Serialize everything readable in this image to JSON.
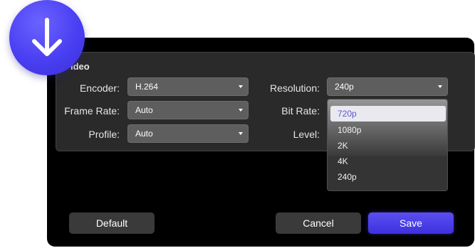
{
  "section": {
    "title": "ideo"
  },
  "fields": {
    "encoder": {
      "label": "Encoder:",
      "value": "H.264"
    },
    "frame_rate": {
      "label": "Frame Rate:",
      "value": "Auto"
    },
    "profile": {
      "label": "Profile:",
      "value": "Auto"
    },
    "resolution": {
      "label": "Resolution:",
      "value": "240p"
    },
    "bit_rate": {
      "label": "Bit Rate:"
    },
    "level": {
      "label": "Level:"
    }
  },
  "resolution_menu": {
    "options": [
      "720p",
      "1080p",
      "2K",
      "4K",
      "240p"
    ],
    "highlighted": "720p"
  },
  "buttons": {
    "default": "Default",
    "cancel": "Cancel",
    "save": "Save"
  },
  "badge_icon": "download-arrow-icon",
  "colors": {
    "accent": "#4a3ff2",
    "panel": "#000000",
    "group": "#2a2a2a",
    "select": "#5e5e5e",
    "highlight_text": "#5b55d8"
  }
}
